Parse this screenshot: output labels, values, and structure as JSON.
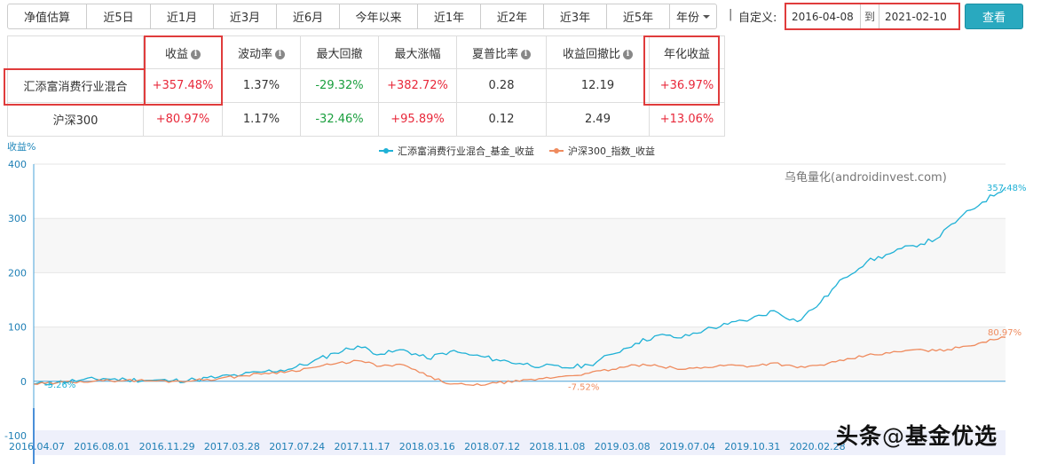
{
  "tabs": [
    {
      "label": "净值估算"
    },
    {
      "label": "近5日"
    },
    {
      "label": "近1月"
    },
    {
      "label": "近3月"
    },
    {
      "label": "近6月"
    },
    {
      "label": "今年以来"
    },
    {
      "label": "近1年"
    },
    {
      "label": "近2年"
    },
    {
      "label": "近3年"
    },
    {
      "label": "近5年"
    },
    {
      "label": "年份"
    }
  ],
  "separator": "|",
  "custom": {
    "label": "自定义:",
    "start": "2016-04-08",
    "to": "到",
    "end": "2021-02-10",
    "query_label": "查看"
  },
  "table": {
    "headers": [
      "",
      "收益",
      "波动率",
      "最大回撤",
      "最大涨幅",
      "夏普比率",
      "收益回撤比",
      "年化收益"
    ],
    "rows": [
      {
        "name": "汇添富消费行业混合",
        "cells": [
          "+357.48%",
          "1.37%",
          "-29.32%",
          "+382.72%",
          "0.28",
          "12.19",
          "+36.97%"
        ]
      },
      {
        "name": "沪深300",
        "cells": [
          "+80.97%",
          "1.17%",
          "-32.46%",
          "+95.89%",
          "0.12",
          "2.49",
          "+13.06%"
        ]
      }
    ]
  },
  "watermark": "乌龟量化(androidinvest.com)",
  "footer_mark": {
    "head": "头条",
    "at": "@",
    "name": "基金优选"
  },
  "chart_data": {
    "type": "line",
    "ylabel": "收益%",
    "ylim": [
      -100,
      400
    ],
    "yticks": [
      -100,
      0,
      100,
      200,
      300,
      400
    ],
    "x_ticks": [
      "2016.04.07",
      "2016.08.01",
      "2016.11.29",
      "2017.03.28",
      "2017.07.24",
      "2017.11.17",
      "2018.03.16",
      "2018.07.12",
      "2018.11.08",
      "2019.03.08",
      "2019.07.04",
      "2019.10.31",
      "2020.02.28"
    ],
    "annotations": [
      "-5.26%",
      "-7.52%",
      "357.48%",
      "80.97%"
    ],
    "colors": {
      "fund": "#1fb1d6",
      "index": "#ef8b5e"
    },
    "series": [
      {
        "name": "汇添富消费行业混合_基金_收益",
        "values": [
          -5.26,
          -2,
          2,
          5,
          3,
          2,
          1,
          3,
          8,
          12,
          18,
          22,
          35,
          52,
          65,
          50,
          58,
          42,
          55,
          48,
          40,
          33,
          28,
          25,
          30,
          50,
          70,
          85,
          80,
          95,
          105,
          115,
          130,
          110,
          145,
          190,
          220,
          235,
          250,
          262,
          300,
          330,
          357.48
        ]
      },
      {
        "name": "沪深300_指数_收益",
        "values": [
          -5.26,
          -3,
          0,
          1,
          2,
          1,
          0,
          2,
          5,
          10,
          15,
          18,
          25,
          32,
          38,
          28,
          30,
          10,
          -5,
          -7.52,
          -3,
          0,
          5,
          10,
          15,
          22,
          30,
          28,
          22,
          26,
          30,
          28,
          34,
          25,
          30,
          38,
          48,
          52,
          58,
          56,
          62,
          72,
          80.97
        ]
      }
    ]
  }
}
